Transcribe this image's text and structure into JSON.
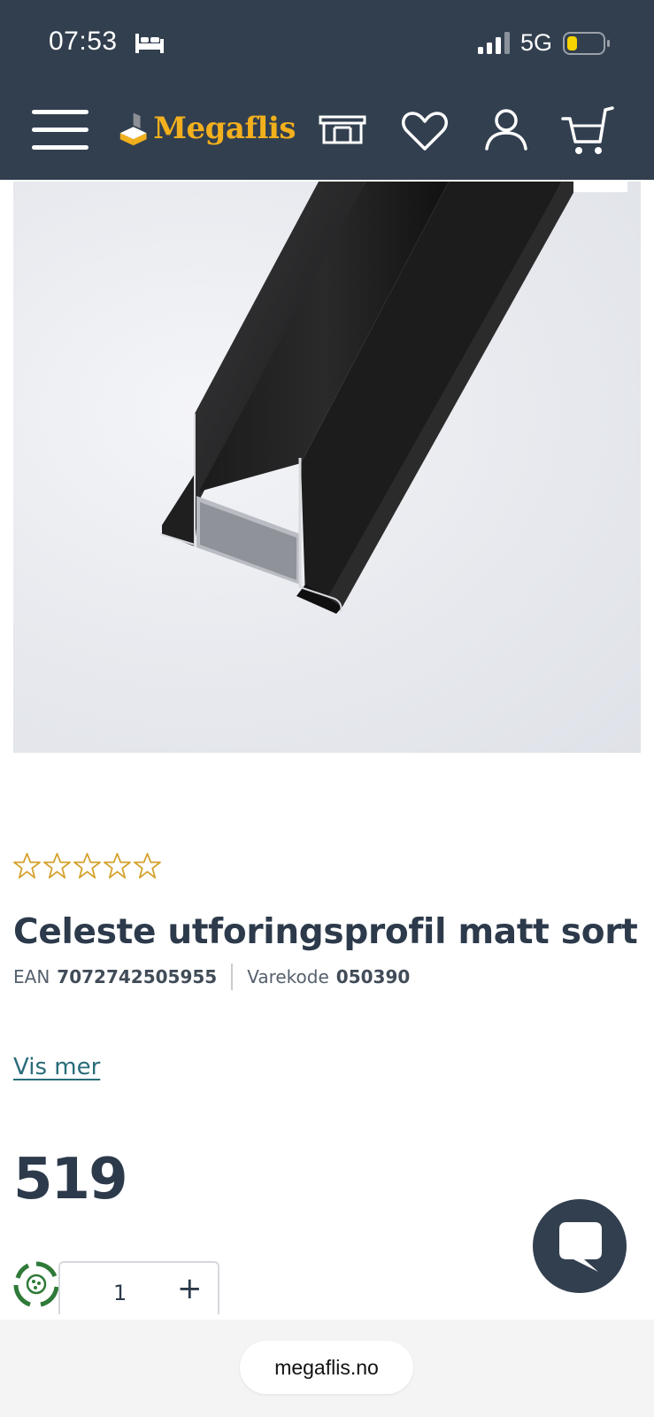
{
  "status_bar": {
    "time": "07:53",
    "network": "5G",
    "icons": [
      "bed-icon",
      "signal-icon",
      "battery-icon"
    ]
  },
  "header": {
    "brand": "Megaflis",
    "icons": [
      "menu-icon",
      "store-icon",
      "heart-icon",
      "user-icon",
      "cart-icon"
    ],
    "colors": {
      "background": "#323f4f",
      "brand": "#f2b01d"
    }
  },
  "product": {
    "rating_stars": 0,
    "rating_max": 5,
    "title": "Celeste utforingsprofil matt sort",
    "ean_label": "EAN",
    "ean": "7072742505955",
    "code_label": "Varekode",
    "code": "050390",
    "more_link": "Vis mer",
    "price": "519"
  },
  "quantity": {
    "value": "1",
    "plus": "+"
  },
  "browser": {
    "url": "megaflis.no"
  }
}
